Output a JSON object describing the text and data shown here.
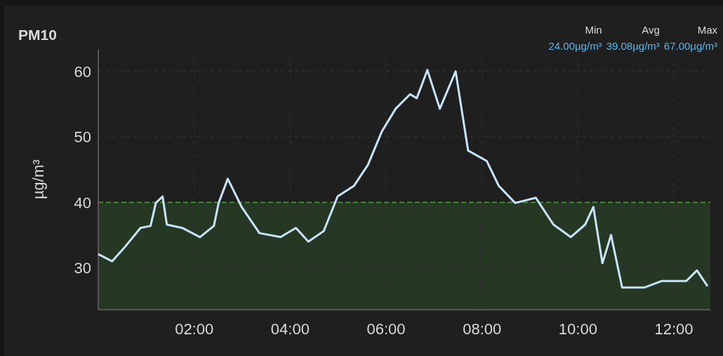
{
  "panel": {
    "title": "PM10",
    "legend": [
      {
        "label": "Min",
        "value": "24.00µg/m³"
      },
      {
        "label": "Avg",
        "value": "39.08µg/m³"
      },
      {
        "label": "Max",
        "value": "67.00µg/m³"
      }
    ],
    "chart_data": {
      "type": "line",
      "ylabel": "µg/m³",
      "x": [
        0,
        0.29,
        0.58,
        0.88,
        1.09,
        1.2,
        1.34,
        1.43,
        1.75,
        2.12,
        2.41,
        2.51,
        2.7,
        2.99,
        3.36,
        3.8,
        4.12,
        4.38,
        4.7,
        4.99,
        5.33,
        5.62,
        5.91,
        6.2,
        6.5,
        6.64,
        6.86,
        7.12,
        7.45,
        7.71,
        8.1,
        8.35,
        8.69,
        9.12,
        9.49,
        9.85,
        10.15,
        10.32,
        10.51,
        10.69,
        10.92,
        11.39,
        11.75,
        12.26,
        12.48,
        12.7
      ],
      "series": [
        {
          "color": "#c8e4f8",
          "values": [
            32.1,
            31,
            33.4,
            36.1,
            36.4,
            39.9,
            40.9,
            36.6,
            36.1,
            34.7,
            36.4,
            39.9,
            43.6,
            39.3,
            35.3,
            34.7,
            36.1,
            34,
            35.6,
            40.9,
            42.5,
            45.7,
            50.8,
            54.3,
            56.5,
            55.9,
            60.2,
            54.3,
            60,
            47.9,
            46.3,
            42.5,
            39.9,
            40.7,
            36.6,
            34.7,
            36.6,
            39.3,
            30.7,
            35,
            27,
            27,
            28,
            28,
            29.6,
            27.2
          ]
        }
      ],
      "xlim": [
        0,
        12.76
      ],
      "ylim": [
        23.6,
        63.4
      ],
      "xticks": [
        {
          "value": 2,
          "label": "02:00"
        },
        {
          "value": 4,
          "label": "04:00"
        },
        {
          "value": 6,
          "label": "06:00"
        },
        {
          "value": 8,
          "label": "08:00"
        },
        {
          "value": 10,
          "label": "10:00"
        },
        {
          "value": 12,
          "label": "12:00"
        }
      ],
      "yticks": [
        30,
        40,
        50,
        60
      ],
      "grid": true,
      "ref_lines": [
        {
          "axis": "y",
          "value": 40,
          "color": "#3f8c2f"
        }
      ]
    }
  }
}
